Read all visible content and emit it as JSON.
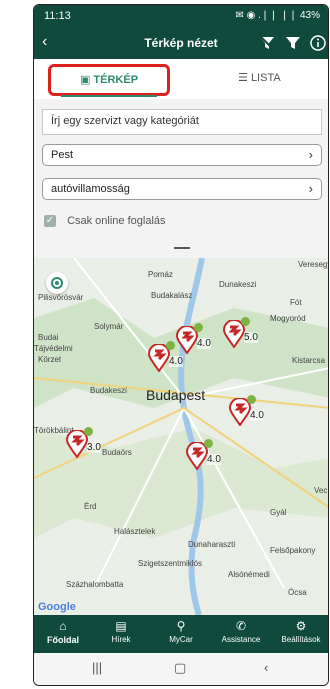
{
  "status": {
    "time": "11:13",
    "right": "✉ ◉ .❘❘ ❘❘ 43%"
  },
  "appbar": {
    "title": "Térkép nézet",
    "back_icon": "chevron-left-icon",
    "icons": [
      "no-filter-icon",
      "filter-icon",
      "info-icon"
    ]
  },
  "tabs": {
    "map": "TÉRKÉP",
    "list": "LISTA"
  },
  "search": {
    "placeholder": "Írj egy szervizt vagy kategóriát"
  },
  "filters": {
    "location": "Pest",
    "category": "autóvillamosság"
  },
  "checkbox": {
    "label": "Csak online foglalás",
    "checked": true
  },
  "map": {
    "labels": [
      "Pomáz",
      "Dunakeszi",
      "Veresegy",
      "Pilisvörösvár",
      "Budakalász",
      "Fót",
      "Solymár",
      "Mogyoród",
      "Budai",
      "Tájvédelmi",
      "Körzet",
      "Kistarcsa",
      "Budakeszi",
      "Budapest",
      "Törökbálint",
      "Budaörs",
      "Érd",
      "Gyál",
      "Halásztelek",
      "Dunaharaszti",
      "Felsőpakony",
      "Szigetszentmiklós",
      "Alsónémedi",
      "Százhalombatta",
      "Ócsa",
      "Vec"
    ],
    "attribution": "Google",
    "pins": [
      {
        "rating": "4.0"
      },
      {
        "rating": "4.0"
      },
      {
        "rating": "5.0"
      },
      {
        "rating": "4.0"
      },
      {
        "rating": "3.0"
      },
      {
        "rating": "4.0"
      }
    ]
  },
  "bottomnav": [
    {
      "label": "Főoldal",
      "icon": "home-icon",
      "active": true
    },
    {
      "label": "Hírek",
      "icon": "news-icon"
    },
    {
      "label": "MyCar",
      "icon": "car-icon"
    },
    {
      "label": "Assistance",
      "icon": "phone-icon"
    },
    {
      "label": "Beállítások",
      "icon": "gear-icon"
    }
  ],
  "colors": {
    "primary": "#0f4a3d",
    "accent": "#2f8a6f",
    "highlight": "#e0201d",
    "pin": "#c62828"
  }
}
